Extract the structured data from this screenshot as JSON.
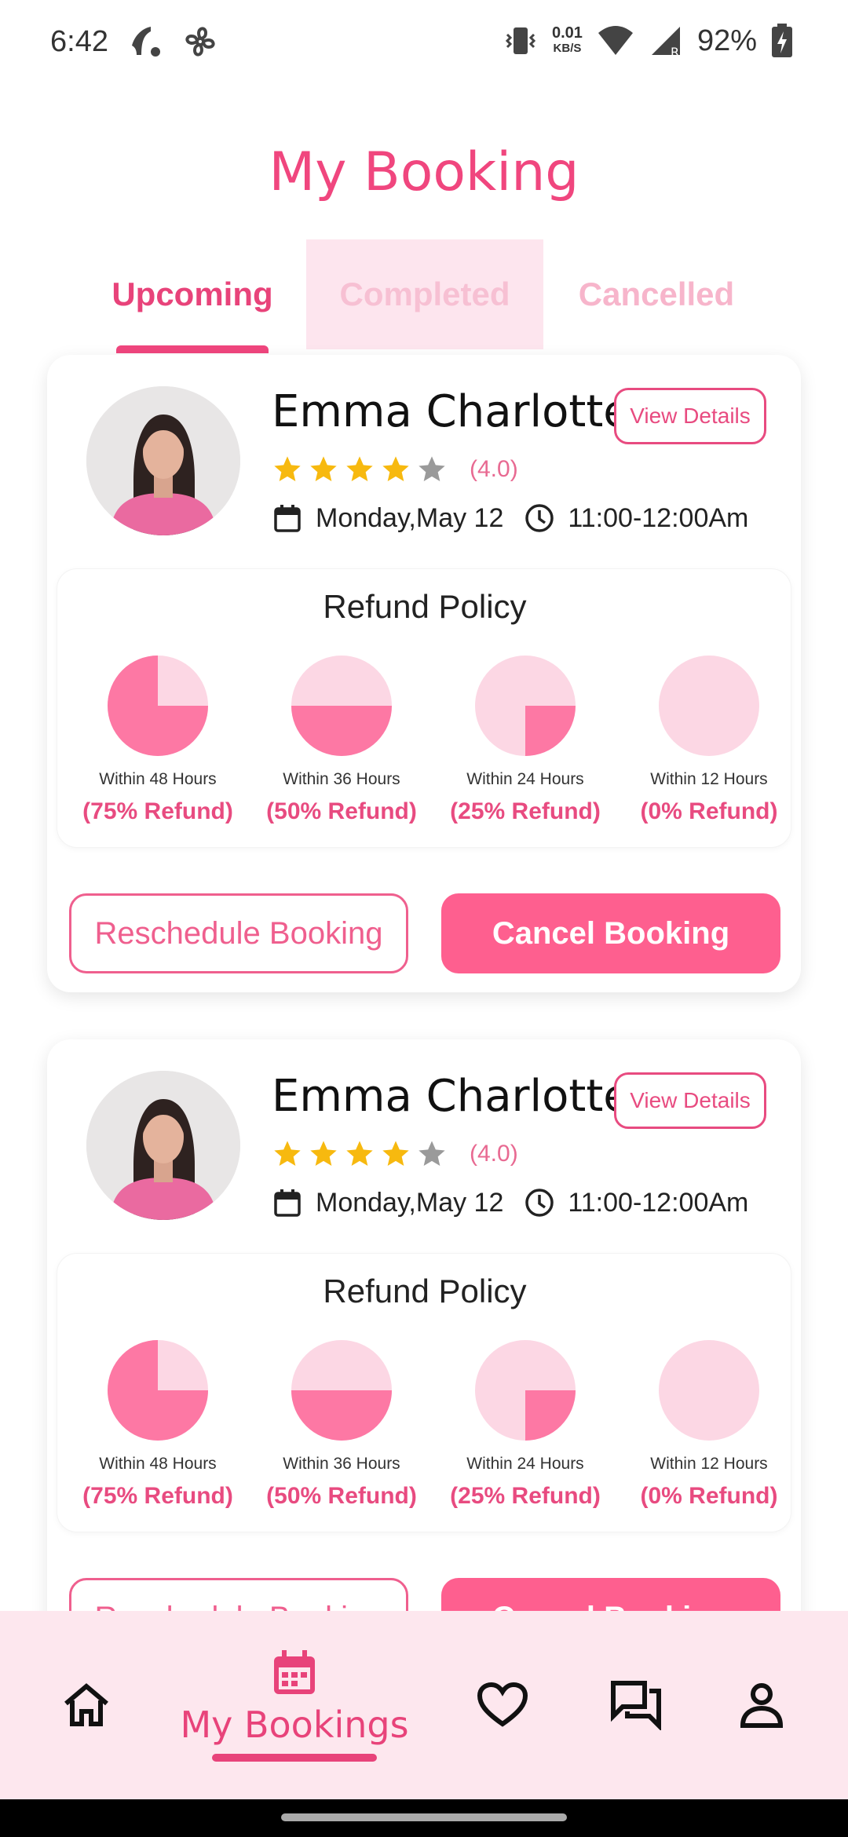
{
  "status_bar": {
    "time": "6:42",
    "net_speed_value": "0.01",
    "net_speed_unit": "KB/S",
    "battery": "92%"
  },
  "page": {
    "title": "My Booking"
  },
  "tabs": [
    {
      "label": "Upcoming",
      "active": true
    },
    {
      "label": "Completed",
      "active": false
    },
    {
      "label": "Cancelled",
      "active": false
    }
  ],
  "bookings": [
    {
      "name": "Emma Charlotte",
      "view_details": "View Details",
      "rating": 4.0,
      "rating_text": "(4.0)",
      "date": "Monday,May 12",
      "time": "11:00-12:00Am",
      "refund_title": "Refund Policy",
      "refunds": [
        {
          "label": "Within 48 Hours",
          "value": "(75% Refund)",
          "fraction": 0.75
        },
        {
          "label": "Within 36 Hours",
          "value": "(50% Refund)",
          "fraction": 0.5
        },
        {
          "label": "Within 24 Hours",
          "value": "(25% Refund)",
          "fraction": 0.25
        },
        {
          "label": "Within 12 Hours",
          "value": "(0% Refund)",
          "fraction": 0
        }
      ],
      "reschedule_label": "Reschedule Booking",
      "cancel_label": "Cancel Booking"
    },
    {
      "name": "Emma Charlotte",
      "view_details": "View Details",
      "rating": 4.0,
      "rating_text": "(4.0)",
      "date": "Monday,May 12",
      "time": "11:00-12:00Am",
      "refund_title": "Refund Policy",
      "refunds": [
        {
          "label": "Within 48 Hours",
          "value": "(75% Refund)",
          "fraction": 0.75
        },
        {
          "label": "Within 36 Hours",
          "value": "(50% Refund)",
          "fraction": 0.5
        },
        {
          "label": "Within 24 Hours",
          "value": "(25% Refund)",
          "fraction": 0.25
        },
        {
          "label": "Within 12 Hours",
          "value": "(0% Refund)",
          "fraction": 0
        }
      ],
      "reschedule_label": "Reschedule Booking",
      "cancel_label": "Cancel Booking"
    }
  ],
  "bottom_nav": {
    "active_label": "My Bookings",
    "items": [
      "home-icon",
      "calendar-icon",
      "heart-icon",
      "chat-icon",
      "profile-icon"
    ]
  },
  "colors": {
    "accent": "#f0467e",
    "pie_fill": "#fd78a4",
    "pie_bg": "#fcd7e4",
    "star": "#f7b90f",
    "star_empty": "#9a9a9a"
  }
}
